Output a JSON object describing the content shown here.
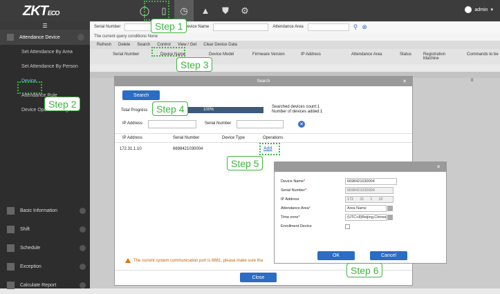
{
  "app": {
    "logo_main": "ZKT",
    "logo_sub": "ECO",
    "user": "admin"
  },
  "nav": [
    "user-icon",
    "door-icon",
    "clock-icon",
    "elevator-icon",
    "shield-icon",
    "gear-icon"
  ],
  "sidebar": {
    "section": "Attendance Device",
    "items": [
      {
        "label": "Set Attendance By Area"
      },
      {
        "label": "Set Attendance By Person"
      },
      {
        "label": "Device"
      },
      {
        "label": "Attendance Rule"
      },
      {
        "label": "Device Operation Log"
      }
    ],
    "modules": [
      "Basic Information",
      "Shift",
      "Schedule",
      "Exception",
      "Calculate Report"
    ]
  },
  "filter": {
    "serial_label": "Serial Number",
    "name_label": "Device Name",
    "area_label": "Attendance Area"
  },
  "conditions": "The current query conditions None",
  "toolbar": {
    "refresh": "Refresh",
    "delete": "Delete",
    "search": "Search",
    "control": "Control",
    "view": "View / Get",
    "clear": "Clear Device Data"
  },
  "table": {
    "headers": [
      "Serial Number",
      "Device Name",
      "Device Model",
      "Firmware Version",
      "IP Address",
      "Attendance Area",
      "Status",
      "Registration Machine",
      "Commands to be"
    ],
    "row_value": "0"
  },
  "search_dialog": {
    "title": "Search",
    "search_button": "Search",
    "total_progress": "Total Progress",
    "progress_value": "100%",
    "progress_fraction": 1.0,
    "count_line1": "Searched devices count:1",
    "count_line2": "Number of devices added:1",
    "ip_label": "IP Address",
    "serial_label": "Serial Number",
    "col_ip": "IP Address",
    "col_serial": "Serial Number",
    "col_type": "Device Type",
    "col_ops": "Operations",
    "row_ip": "172.31.1.10",
    "row_serial": "6698421030004",
    "row_add": "Add",
    "warning": "The current system communication port is 8881, please make sure tha",
    "close": "Close"
  },
  "add_dialog": {
    "device_name_label": "Device Name",
    "device_name_value": "6698421030004",
    "serial_label": "Serial Number",
    "serial_value": "6698421030004",
    "ip_label": "IP Address",
    "ip1": "172",
    "ip2": "31",
    "ip3": "1",
    "ip4": "10",
    "area_label": "Attendance Area",
    "area_value": "Area Name",
    "tz_label": "Time zone",
    "tz_value": "(UTC+8)Beijing,Chines",
    "enroll_label": "Enrollment Device",
    "ok": "OK",
    "cancel": "Cancel"
  },
  "steps": {
    "s1": "Step 1",
    "s2": "Step 2",
    "s3": "Step 3",
    "s4": "Step 4",
    "s5": "Step 5",
    "s6": "Step 6"
  },
  "colors": {
    "accent": "#2b6cc4",
    "step": "#3cb43c"
  }
}
